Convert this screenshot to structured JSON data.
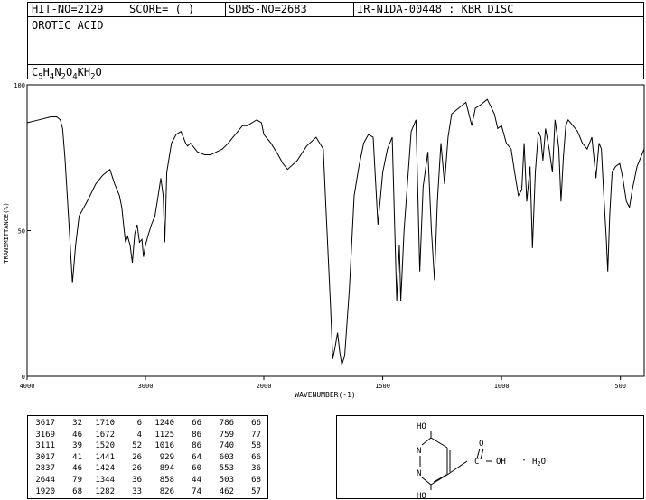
{
  "header": {
    "hit_no": "HIT-NO=2129",
    "score": "SCORE=  (  )",
    "sdbs_no": "SDBS-NO=2683",
    "ir_id": "IR-NIDA-00448 : KBR DISC",
    "compound_name": "OROTIC ACID",
    "formula_parts": [
      {
        "t": "C",
        "s": "5"
      },
      {
        "t": "H",
        "s": "4"
      },
      {
        "t": "N",
        "s": "2"
      },
      {
        "t": "O",
        "s": "4"
      },
      {
        "t": "KH",
        "s": "2"
      },
      {
        "t": "O",
        "s": ""
      }
    ]
  },
  "chart_data": {
    "type": "line",
    "xlabel": "WAVENUMBER(-1)",
    "ylabel": "TRANSMITTANCE(%)",
    "xlim": [
      4000,
      400
    ],
    "ylim": [
      0,
      100
    ],
    "x_ticks": [
      4000,
      3000,
      2000,
      1500,
      1000,
      500
    ],
    "y_ticks": [
      0,
      50,
      100
    ],
    "grid": false,
    "series": [
      {
        "x": [
          4000,
          3900,
          3800,
          3750,
          3720,
          3700,
          3680,
          3650,
          3617,
          3590,
          3560,
          3520,
          3480,
          3420,
          3360,
          3300,
          3260,
          3220,
          3200,
          3185,
          3169,
          3150,
          3130,
          3111,
          3090,
          3070,
          3050,
          3030,
          3017,
          3000,
          2980,
          2950,
          2920,
          2900,
          2870,
          2850,
          2837,
          2820,
          2780,
          2740,
          2700,
          2660,
          2644,
          2620,
          2560,
          2500,
          2450,
          2400,
          2350,
          2300,
          2260,
          2220,
          2180,
          2140,
          2100,
          2060,
          2020,
          2000,
          1970,
          1940,
          1920,
          1900,
          1860,
          1820,
          1780,
          1750,
          1740,
          1720,
          1710,
          1700,
          1690,
          1680,
          1672,
          1660,
          1640,
          1620,
          1600,
          1580,
          1560,
          1540,
          1520,
          1500,
          1480,
          1460,
          1441,
          1430,
          1424,
          1410,
          1380,
          1360,
          1344,
          1330,
          1310,
          1295,
          1282,
          1270,
          1255,
          1240,
          1225,
          1210,
          1180,
          1150,
          1125,
          1110,
          1090,
          1060,
          1030,
          1016,
          1000,
          980,
          960,
          945,
          929,
          915,
          905,
          894,
          880,
          870,
          858,
          845,
          835,
          826,
          815,
          800,
          786,
          775,
          765,
          759,
          750,
          740,
          730,
          720,
          700,
          680,
          660,
          640,
          620,
          603,
          590,
          580,
          570,
          560,
          553,
          545,
          535,
          520,
          503,
          490,
          475,
          462,
          450,
          430,
          400
        ],
        "y": [
          87,
          88,
          89,
          89,
          88,
          85,
          75,
          55,
          32,
          45,
          55,
          58,
          61,
          66,
          69,
          71,
          66,
          62,
          58,
          52,
          46,
          48,
          45,
          39,
          49,
          52,
          46,
          47,
          41,
          45,
          48,
          52,
          55,
          60,
          68,
          62,
          46,
          70,
          80,
          83,
          84,
          80,
          79,
          80,
          77,
          76,
          76,
          77,
          78,
          80,
          82,
          84,
          86,
          86,
          87,
          88,
          87,
          83,
          80,
          76,
          73,
          71,
          74,
          79,
          82,
          78,
          60,
          25,
          6,
          10,
          15,
          8,
          4,
          7,
          30,
          62,
          72,
          80,
          83,
          82,
          52,
          70,
          78,
          82,
          26,
          45,
          26,
          50,
          84,
          88,
          36,
          65,
          77,
          50,
          33,
          60,
          80,
          66,
          82,
          90,
          92,
          94,
          86,
          92,
          93,
          95,
          90,
          85,
          86,
          80,
          78,
          70,
          62,
          64,
          80,
          60,
          72,
          44,
          70,
          84,
          82,
          74,
          85,
          78,
          70,
          88,
          82,
          78,
          60,
          75,
          86,
          88,
          86,
          84,
          80,
          78,
          82,
          68,
          80,
          78,
          62,
          48,
          36,
          55,
          70,
          72,
          73,
          68,
          60,
          58,
          64,
          72,
          78
        ]
      }
    ]
  },
  "peak_table": {
    "columns": [
      [
        [
          "3617",
          "32"
        ],
        [
          "3169",
          "46"
        ],
        [
          "3111",
          "39"
        ],
        [
          "3017",
          "41"
        ],
        [
          "2837",
          "46"
        ],
        [
          "2644",
          "79"
        ],
        [
          "1920",
          "68"
        ]
      ],
      [
        [
          "1710",
          "6"
        ],
        [
          "1672",
          "4"
        ],
        [
          "1520",
          "52"
        ],
        [
          "1441",
          "26"
        ],
        [
          "1424",
          "26"
        ],
        [
          "1344",
          "36"
        ],
        [
          "1282",
          "33"
        ]
      ],
      [
        [
          "1240",
          "66"
        ],
        [
          "1125",
          "86"
        ],
        [
          "1016",
          "86"
        ],
        [
          "929",
          "64"
        ],
        [
          "894",
          "60"
        ],
        [
          "858",
          "44"
        ],
        [
          "826",
          "74"
        ]
      ],
      [
        [
          "786",
          "66"
        ],
        [
          "759",
          "77"
        ],
        [
          "740",
          "58"
        ],
        [
          "603",
          "66"
        ],
        [
          "553",
          "36"
        ],
        [
          "503",
          "68"
        ],
        [
          "462",
          "57"
        ]
      ]
    ]
  },
  "structure": {
    "top_label": "HO",
    "bottom_label": "HO",
    "n_top": "N",
    "n_bottom": "N",
    "c_label": "C",
    "oh_label": "OH",
    "dot": "·",
    "water": "H",
    "water_sub": "2",
    "water_tail": "O",
    "carbonyl_o": "O"
  }
}
